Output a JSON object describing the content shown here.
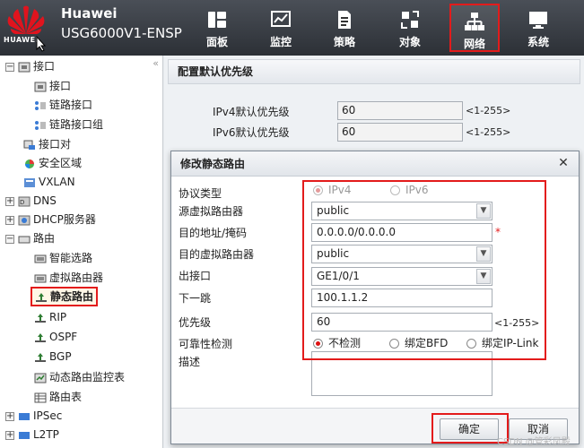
{
  "header": {
    "logo_text": "HUAWEI",
    "brand": "Huawei",
    "model": "USG6000V1-ENSP",
    "nav": [
      {
        "label": "面板",
        "icon": "dashboard-icon"
      },
      {
        "label": "监控",
        "icon": "monitor-chart-icon"
      },
      {
        "label": "策略",
        "icon": "policy-document-icon"
      },
      {
        "label": "对象",
        "icon": "object-icon"
      },
      {
        "label": "网络",
        "icon": "network-topology-icon"
      },
      {
        "label": "系统",
        "icon": "system-monitor-icon"
      }
    ],
    "active_nav": "网络",
    "accent_color": "#e31b1b"
  },
  "sidebar": {
    "items": [
      {
        "label": "接口",
        "icon": "interface-icon",
        "toggle": "−"
      },
      {
        "label": "接口",
        "icon": "interface-icon"
      },
      {
        "label": "链路接口",
        "icon": "link-interface-icon"
      },
      {
        "label": "链路接口组",
        "icon": "link-interface-group-icon"
      },
      {
        "label": "接口对",
        "icon": "interface-pair-icon"
      },
      {
        "label": "安全区域",
        "icon": "security-zone-icon"
      },
      {
        "label": "VXLAN",
        "icon": "vxlan-icon"
      },
      {
        "label": "DNS",
        "icon": "dns-icon",
        "toggle": "+"
      },
      {
        "label": "DHCP服务器",
        "icon": "dhcp-icon",
        "toggle": "+"
      },
      {
        "label": "路由",
        "icon": "route-icon",
        "toggle": "−"
      },
      {
        "label": "智能选路",
        "icon": "smart-route-icon"
      },
      {
        "label": "虚拟路由器",
        "icon": "virtual-router-icon"
      },
      {
        "label": "静态路由",
        "icon": "static-route-icon"
      },
      {
        "label": "RIP",
        "icon": "rip-icon"
      },
      {
        "label": "OSPF",
        "icon": "ospf-icon"
      },
      {
        "label": "BGP",
        "icon": "bgp-icon"
      },
      {
        "label": "动态路由监控表",
        "icon": "dynamic-route-monitor-icon"
      },
      {
        "label": "路由表",
        "icon": "route-table-icon"
      },
      {
        "label": "IPSec",
        "icon": "ipsec-icon",
        "toggle": "+"
      },
      {
        "label": "L2TP",
        "icon": "l2tp-icon",
        "toggle": "+"
      }
    ],
    "selected": "静态路由"
  },
  "main": {
    "section_title": "配置默认优先级",
    "ipv4_label": "IPv4默认优先级",
    "ipv4_value": "60",
    "ipv4_range": "<1-255>",
    "ipv6_label": "IPv6默认优先级",
    "ipv6_value": "60",
    "ipv6_range": "<1-255>"
  },
  "dialog": {
    "title": "修改静态路由",
    "protocol_label": "协议类型",
    "protocol_options": [
      "IPv4",
      "IPv6"
    ],
    "protocol_selected": "IPv4",
    "src_vrouter_label": "源虚拟路由器",
    "src_vrouter_value": "public",
    "dest_addr_label": "目的地址/掩码",
    "dest_addr_value": "0.0.0.0/0.0.0.0",
    "required_mark": "*",
    "dest_vrouter_label": "目的虚拟路由器",
    "dest_vrouter_value": "public",
    "egress_label": "出接口",
    "egress_value": "GE1/0/1",
    "nexthop_label": "下一跳",
    "nexthop_value": "100.1.1.2",
    "priority_label": "优先级",
    "priority_value": "60",
    "priority_range": "<1-255>",
    "reachability_label": "可靠性检测",
    "reachability_options": [
      "不检测",
      "绑定BFD",
      "绑定IP-Link"
    ],
    "reachability_selected": "不检测",
    "desc_label": "描述",
    "desc_value": "",
    "ok_label": "确定",
    "cancel_label": "取消"
  },
  "watermark": "CSDN @管彩凤殿"
}
